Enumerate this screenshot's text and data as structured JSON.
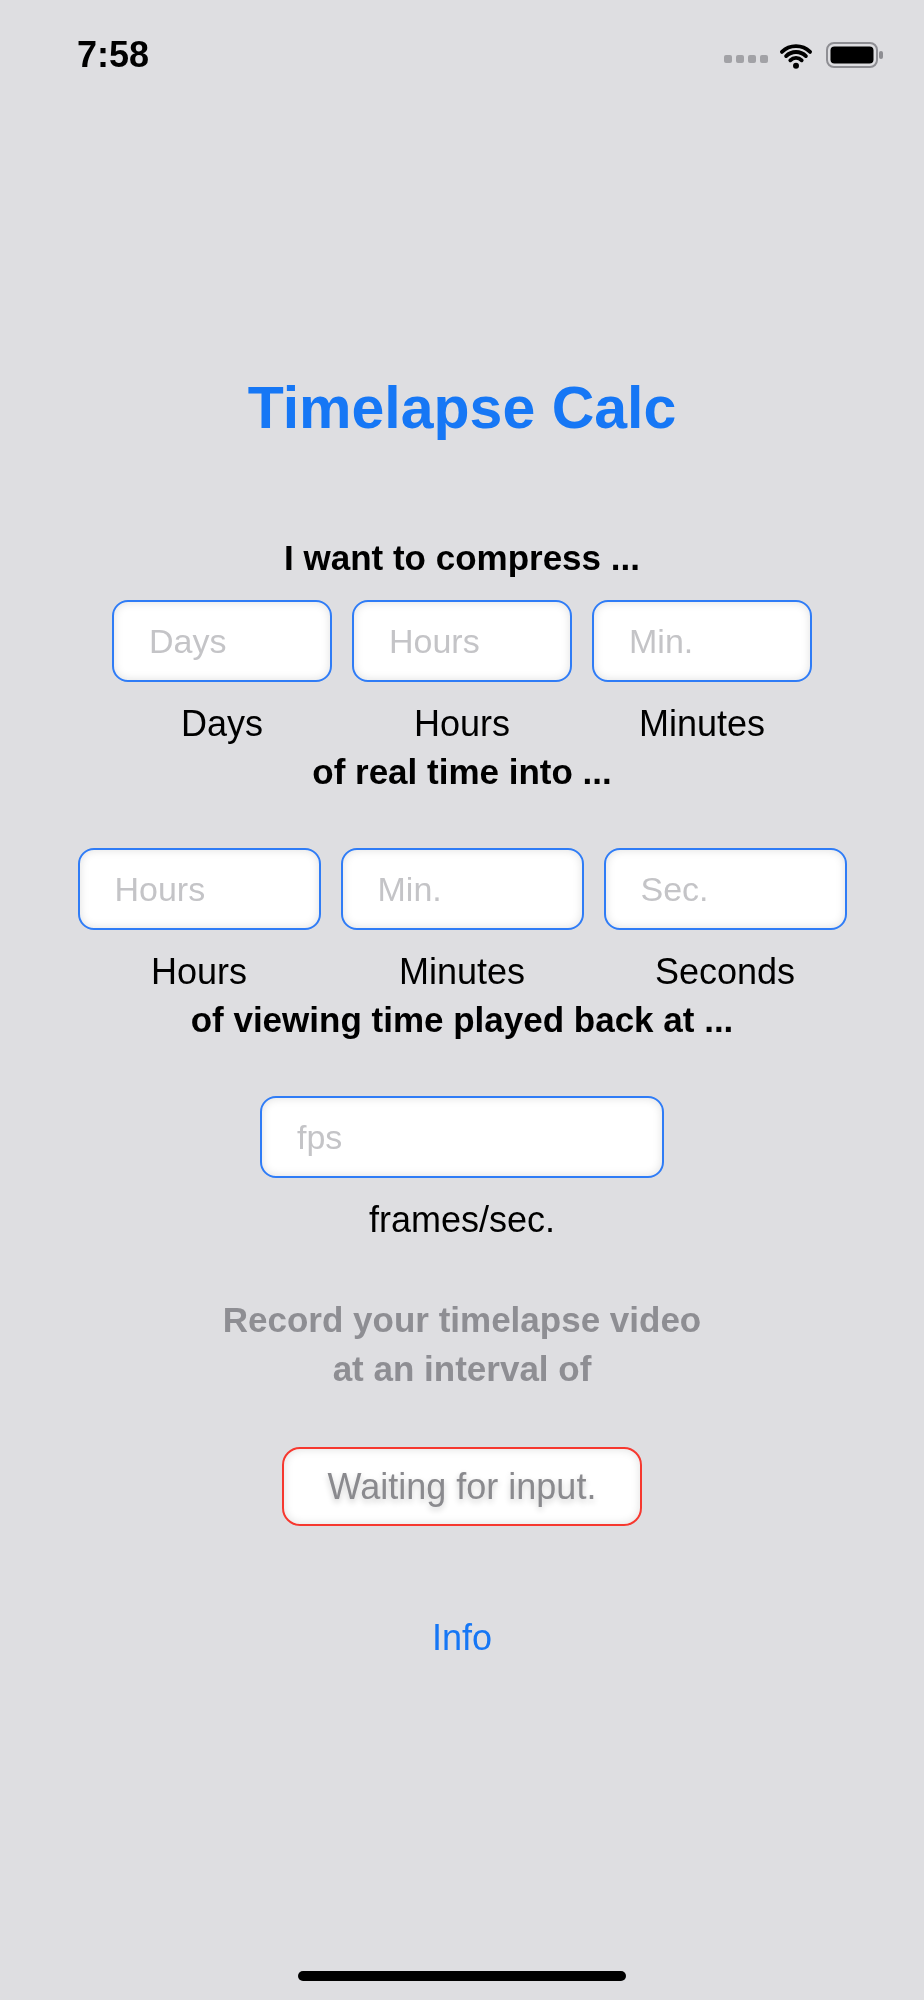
{
  "status_bar": {
    "time": "7:58"
  },
  "title": "Timelapse Calc",
  "sections": [
    {
      "heading": "I want to compress ...",
      "fields": [
        {
          "placeholder": "Days",
          "label": "Days"
        },
        {
          "placeholder": "Hours",
          "label": "Hours"
        },
        {
          "placeholder": "Min.",
          "label": "Minutes"
        }
      ]
    },
    {
      "heading": "of real time into ...",
      "fields": [
        {
          "placeholder": "Hours",
          "label": "Hours"
        },
        {
          "placeholder": "Min.",
          "label": "Minutes"
        },
        {
          "placeholder": "Sec.",
          "label": "Seconds"
        }
      ]
    },
    {
      "heading": "of viewing time played back at ...",
      "fields": [
        {
          "placeholder": "fps",
          "label": "frames/sec."
        }
      ]
    }
  ],
  "result": {
    "caption": "Record your timelapse video\nat an interval of",
    "value": "Waiting for input.",
    "valid": false
  },
  "info_link": "Info"
}
